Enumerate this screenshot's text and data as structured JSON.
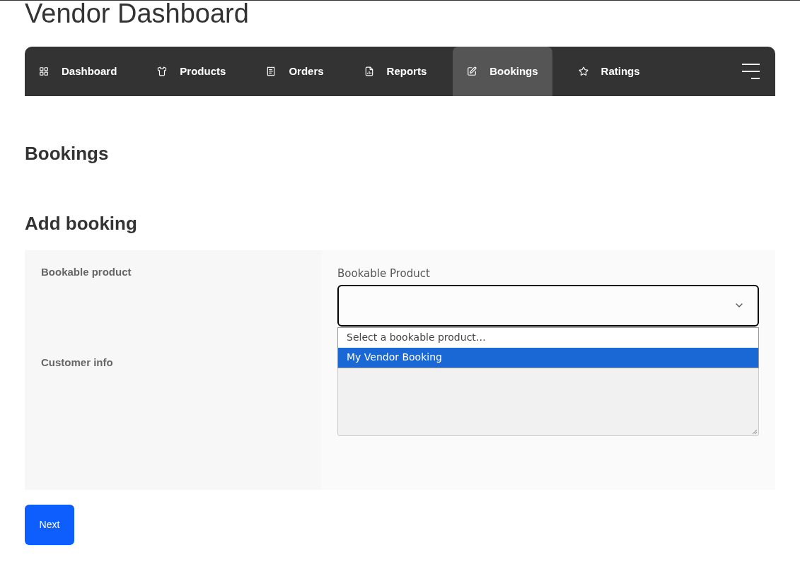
{
  "page_title": "Vendor Dashboard",
  "nav": {
    "items": [
      {
        "label": "Dashboard",
        "kind": "grid",
        "selected": false
      },
      {
        "label": "Products",
        "kind": "shirt",
        "selected": false
      },
      {
        "label": "Orders",
        "kind": "orders",
        "selected": false
      },
      {
        "label": "Reports",
        "kind": "report",
        "selected": false
      },
      {
        "label": "Bookings",
        "kind": "edit",
        "selected": true
      },
      {
        "label": "Ratings",
        "kind": "star",
        "selected": false
      }
    ]
  },
  "section_title": "Bookings",
  "form_title": "Add booking",
  "form": {
    "rows": [
      {
        "kind": "select",
        "label": "Bookable product",
        "field_label": "Bookable Product",
        "expanded": true,
        "options": [
          {
            "label": "Select a bookable product…",
            "selected": false
          },
          {
            "label": "My Vendor Booking",
            "selected": true
          }
        ]
      },
      {
        "kind": "textarea",
        "label": "Customer info",
        "disabled": true
      }
    ]
  },
  "next_button": "Next"
}
